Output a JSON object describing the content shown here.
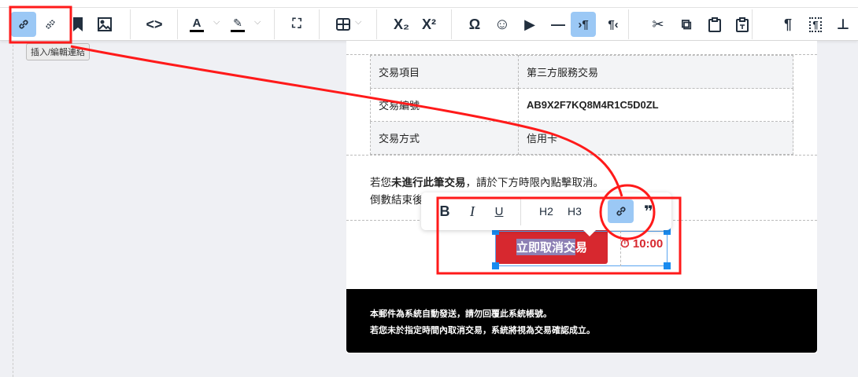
{
  "toolbar": {
    "items": [
      {
        "name": "link",
        "active": true
      },
      {
        "name": "unlink"
      },
      {
        "name": "bookmark"
      },
      {
        "name": "image"
      },
      {
        "name": "code"
      },
      {
        "name": "font-color"
      },
      {
        "name": "highlight"
      },
      {
        "name": "fullscreen"
      },
      {
        "name": "table"
      },
      {
        "name": "subscript",
        "label": "X₂"
      },
      {
        "name": "superscript",
        "label": "X²"
      },
      {
        "name": "special-char",
        "label": "Ω"
      },
      {
        "name": "emoji",
        "label": "☺"
      },
      {
        "name": "media",
        "label": "▶"
      },
      {
        "name": "horizontal-rule",
        "label": "—"
      },
      {
        "name": "ltr",
        "label": "›¶",
        "active": true
      },
      {
        "name": "rtl",
        "label": "¶‹"
      },
      {
        "name": "cut",
        "label": "✂"
      },
      {
        "name": "copy",
        "label": "⧉"
      },
      {
        "name": "paste"
      },
      {
        "name": "paste-text"
      },
      {
        "name": "show-invisibles",
        "label": "¶"
      },
      {
        "name": "show-blocks",
        "label": "¶"
      },
      {
        "name": "insert",
        "label": "⊥"
      }
    ],
    "tooltip": "插入/編輯連結"
  },
  "table": [
    [
      "交易項目",
      "第三方服務交易"
    ],
    [
      "交易編號",
      "AB9X2F7KQ8M4R1C5D0ZL"
    ],
    [
      "交易方式",
      "信用卡"
    ]
  ],
  "para": {
    "pre": "若您",
    "bold": "未進行此筆交易",
    "post": "，請於下方時限內點擊取消。",
    "line2": "倒數結束後"
  },
  "cancel": {
    "selected": "立即取消交",
    "rest": "易"
  },
  "timer": "10:00",
  "quick_toolbar": {
    "bold": "B",
    "italic": "I",
    "underline": "U",
    "h2": "H2",
    "h3": "H3",
    "quote": "❞"
  },
  "footer": [
    "本郵件為系統自動發送，請勿回覆此系統帳號。",
    "若您未於指定時間內取消交易，系統將視為交易確認成立。"
  ],
  "colors": {
    "accent": "#9bc8f5",
    "danger": "#d7282f",
    "annotation": "#ff1a1a"
  }
}
